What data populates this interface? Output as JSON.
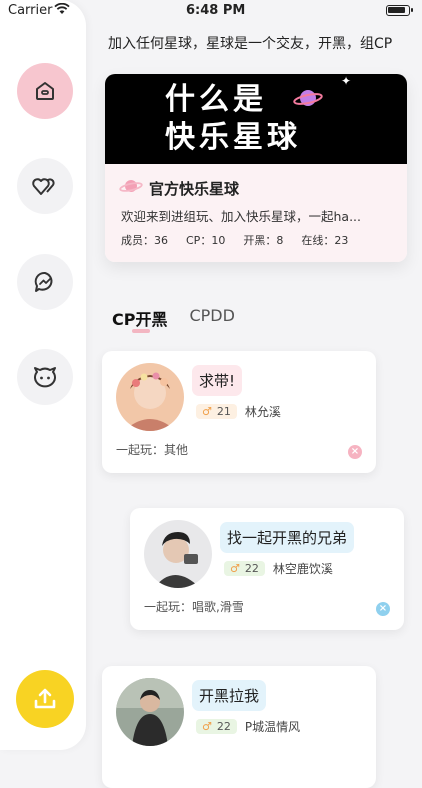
{
  "status_bar": {
    "carrier": "Carrier",
    "time": "6:48 PM"
  },
  "marquee_text": "加入任何星球，星球是一个交友，开黑，组CP",
  "club": {
    "banner_line1": "什么是",
    "banner_line2": "快乐星球",
    "name": "官方快乐星球",
    "description": "欢迎来到进组玩、加入快乐星球，一起ha...",
    "stats": [
      {
        "label": "成员：",
        "value": "36"
      },
      {
        "label": "CP：",
        "value": "10"
      },
      {
        "label": "开黑：",
        "value": "8"
      },
      {
        "label": "在线：",
        "value": "23"
      }
    ]
  },
  "tabs": [
    {
      "label": "CP开黑",
      "active": true
    },
    {
      "label": "CPDD",
      "active": false
    }
  ],
  "posts": [
    {
      "title": "求带!",
      "age": "21",
      "name": "林允溪",
      "play_label": "一起玩：",
      "play": "其他",
      "bubble_color": "#fde8ec",
      "close_color": "#f6b3c1"
    },
    {
      "title": "找一起开黑的兄弟",
      "age": "22",
      "name": "林空鹿饮溪",
      "play_label": "一起玩：",
      "play": "唱歌,滑雪",
      "bubble_color": "#e3f3fb",
      "close_color": "#8fd0ee"
    },
    {
      "title": "开黑拉我",
      "age": "22",
      "name": "P城温情风",
      "play_label": "一起玩：",
      "play": "",
      "bubble_color": "#e3f3fb",
      "close_color": "#8fd0ee"
    }
  ],
  "colors": {
    "accent_pink": "#f7c6cf",
    "accent_yellow": "#f8d323"
  },
  "icons": [
    "home-icon",
    "hearts-icon",
    "messenger-icon",
    "face-icon",
    "upload-icon",
    "wifi-icon",
    "planet-icon"
  ]
}
